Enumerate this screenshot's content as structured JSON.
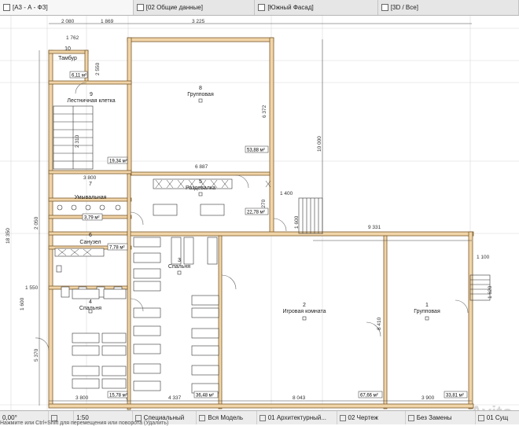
{
  "tabs": [
    {
      "label": "[А3 - А - ФЗ]"
    },
    {
      "label": "[02 Общие данные]"
    },
    {
      "label": "[Южный Фасад]"
    },
    {
      "label": "[3D / Все]"
    }
  ],
  "rooms": [
    {
      "number": "10",
      "name": "Тамбур",
      "area": "6,11 м²"
    },
    {
      "number": "9",
      "name": "Лестничная клетка",
      "area": "19,34 м²"
    },
    {
      "number": "8",
      "name": "Групповая",
      "area": "53,88 м²"
    },
    {
      "number": "5",
      "name": "Раздевалка",
      "area": "22,78 м²"
    },
    {
      "number": "7",
      "name": "Умывальная",
      "area": "3,79 м²"
    },
    {
      "number": "6",
      "name": "Санузел",
      "area": "7,78 м²"
    },
    {
      "number": "3",
      "name": "Спальня",
      "area": "36,48 м²"
    },
    {
      "number": "4",
      "name": "Спальня",
      "area": "15,78 м²"
    },
    {
      "number": "2",
      "name": "Игровая комната",
      "area": "67,66 м²"
    },
    {
      "number": "1",
      "name": "Групповая",
      "area": "33,81 м²"
    }
  ],
  "dimensions": {
    "top1": "2 080",
    "top2": "1 869",
    "top3": "3 225",
    "d1762": "1 762",
    "d2550": "2 550",
    "d6372": "6 372",
    "d6887": "6 887",
    "d3800a": "3 800",
    "d3270": "3 270",
    "d1400": "1 400",
    "d1600": "1 600",
    "d10000": "10 000",
    "d18350": "18 350",
    "d9331": "9 331",
    "d2050": "2 050",
    "d1100": "1 100",
    "d1620": "1 620",
    "d1550": "1 550",
    "d1600b": "1 600",
    "d5370": "5 370",
    "d8410": "8 410",
    "d3800b": "3 800",
    "d4337": "4 337",
    "d8043": "8 043",
    "d3900": "3 900",
    "d2310": "2 310"
  },
  "status": {
    "angle": "0,00°",
    "scale": "1:50",
    "mode": "Специальный",
    "model": "Вся Модель",
    "layer": "01 Архитектурный...",
    "drawing": "02 Чертеж",
    "replace": "Без Замены",
    "suffix": "01 Сущ",
    "hint": "Нажмите или Ctrl+Shift для перемещения или поворота (Удалить)"
  },
  "watermark": "Avito"
}
